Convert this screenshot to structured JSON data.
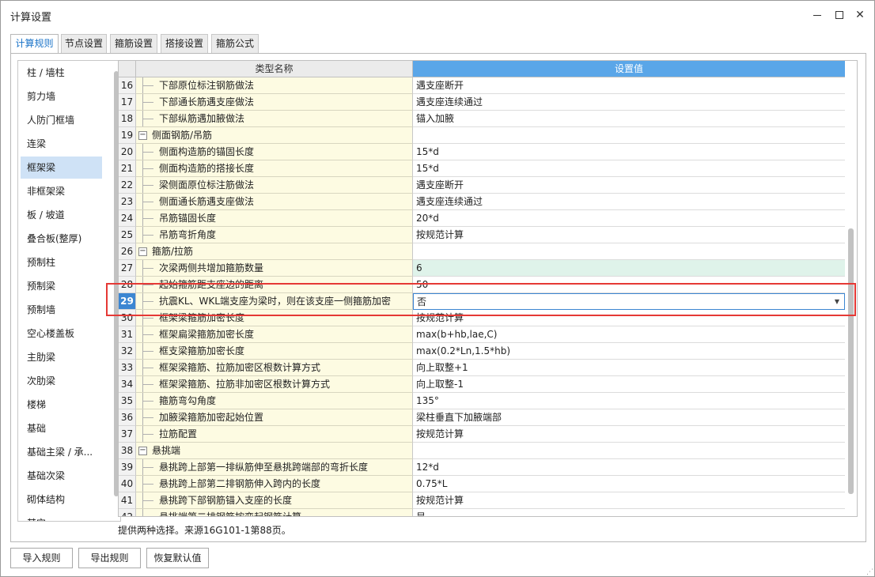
{
  "window": {
    "title": "计算设置"
  },
  "tabs": [
    "计算规则",
    "节点设置",
    "箍筋设置",
    "搭接设置",
    "箍筋公式"
  ],
  "sidebar": {
    "items": [
      "柱 / 墙柱",
      "剪力墙",
      "人防门框墙",
      "连梁",
      "框架梁",
      "非框架梁",
      "板 / 坡道",
      "叠合板(整厚)",
      "预制柱",
      "预制梁",
      "预制墙",
      "空心楼盖板",
      "主肋梁",
      "次肋梁",
      "楼梯",
      "基础",
      "基础主梁 / 承...",
      "基础次梁",
      "砌体结构",
      "其它"
    ],
    "selected_index": 4
  },
  "grid": {
    "columns": {
      "name": "类型名称",
      "value": "设置值"
    },
    "rows": [
      {
        "num": "16",
        "name": "下部原位标注钢筋做法",
        "value": "遇支座断开",
        "type": "leaf"
      },
      {
        "num": "17",
        "name": "下部通长筋遇支座做法",
        "value": "遇支座连续通过",
        "type": "leaf"
      },
      {
        "num": "18",
        "name": "下部纵筋遇加腋做法",
        "value": "锚入加腋",
        "type": "leaf"
      },
      {
        "num": "19",
        "name": "侧面钢筋/吊筋",
        "value": "",
        "type": "group"
      },
      {
        "num": "20",
        "name": "侧面构造筋的锚固长度",
        "value": "15*d",
        "type": "leaf"
      },
      {
        "num": "21",
        "name": "侧面构造筋的搭接长度",
        "value": "15*d",
        "type": "leaf"
      },
      {
        "num": "22",
        "name": "梁侧面原位标注筋做法",
        "value": "遇支座断开",
        "type": "leaf"
      },
      {
        "num": "23",
        "name": "侧面通长筋遇支座做法",
        "value": "遇支座连续通过",
        "type": "leaf"
      },
      {
        "num": "24",
        "name": "吊筋锚固长度",
        "value": "20*d",
        "type": "leaf"
      },
      {
        "num": "25",
        "name": "吊筋弯折角度",
        "value": "按规范计算",
        "type": "leaf"
      },
      {
        "num": "26",
        "name": "箍筋/拉筋",
        "value": "",
        "type": "group"
      },
      {
        "num": "27",
        "name": "次梁两侧共增加箍筋数量",
        "value": "6",
        "type": "leaf",
        "green": true
      },
      {
        "num": "28",
        "name": "起始箍筋距支座边的距离",
        "value": "50",
        "type": "leaf"
      },
      {
        "num": "29",
        "name": "抗震KL、WKL端支座为梁时，则在该支座一侧箍筋加密",
        "value": "否",
        "type": "leaf",
        "editing": true
      },
      {
        "num": "30",
        "name": "框架梁箍筋加密长度",
        "value": "按规范计算",
        "type": "leaf"
      },
      {
        "num": "31",
        "name": "框架扁梁箍筋加密长度",
        "value": "max(b+hb,lae,C)",
        "type": "leaf"
      },
      {
        "num": "32",
        "name": "框支梁箍筋加密长度",
        "value": "max(0.2*Ln,1.5*hb)",
        "type": "leaf"
      },
      {
        "num": "33",
        "name": "框架梁箍筋、拉筋加密区根数计算方式",
        "value": "向上取整+1",
        "type": "leaf"
      },
      {
        "num": "34",
        "name": "框架梁箍筋、拉筋非加密区根数计算方式",
        "value": "向上取整-1",
        "type": "leaf"
      },
      {
        "num": "35",
        "name": "箍筋弯勾角度",
        "value": "135°",
        "type": "leaf"
      },
      {
        "num": "36",
        "name": "加腋梁箍筋加密起始位置",
        "value": "梁柱垂直下加腋端部",
        "type": "leaf"
      },
      {
        "num": "37",
        "name": "拉筋配置",
        "value": "按规范计算",
        "type": "leaf"
      },
      {
        "num": "38",
        "name": "悬挑端",
        "value": "",
        "type": "group"
      },
      {
        "num": "39",
        "name": "悬挑跨上部第一排纵筋伸至悬挑跨端部的弯折长度",
        "value": "12*d",
        "type": "leaf"
      },
      {
        "num": "40",
        "name": "悬挑跨上部第二排钢筋伸入跨内的长度",
        "value": "0.75*L",
        "type": "leaf"
      },
      {
        "num": "41",
        "name": "悬挑跨下部钢筋锚入支座的长度",
        "value": "按规范计算",
        "type": "leaf"
      },
      {
        "num": "42",
        "name": "悬挑端第二排钢筋按弯起钢筋计算",
        "value": "是",
        "type": "leaf"
      }
    ]
  },
  "hint": "提供两种选择。来源16G101-1第88页。",
  "buttons": {
    "import": "导入规则",
    "export": "导出规则",
    "restore": "恢复默认值"
  },
  "colors": {
    "accent": "#3c86d2",
    "header_value": "#5aa6e8",
    "highlight_box": "#e53935",
    "name_bg": "#fdfbe2"
  }
}
